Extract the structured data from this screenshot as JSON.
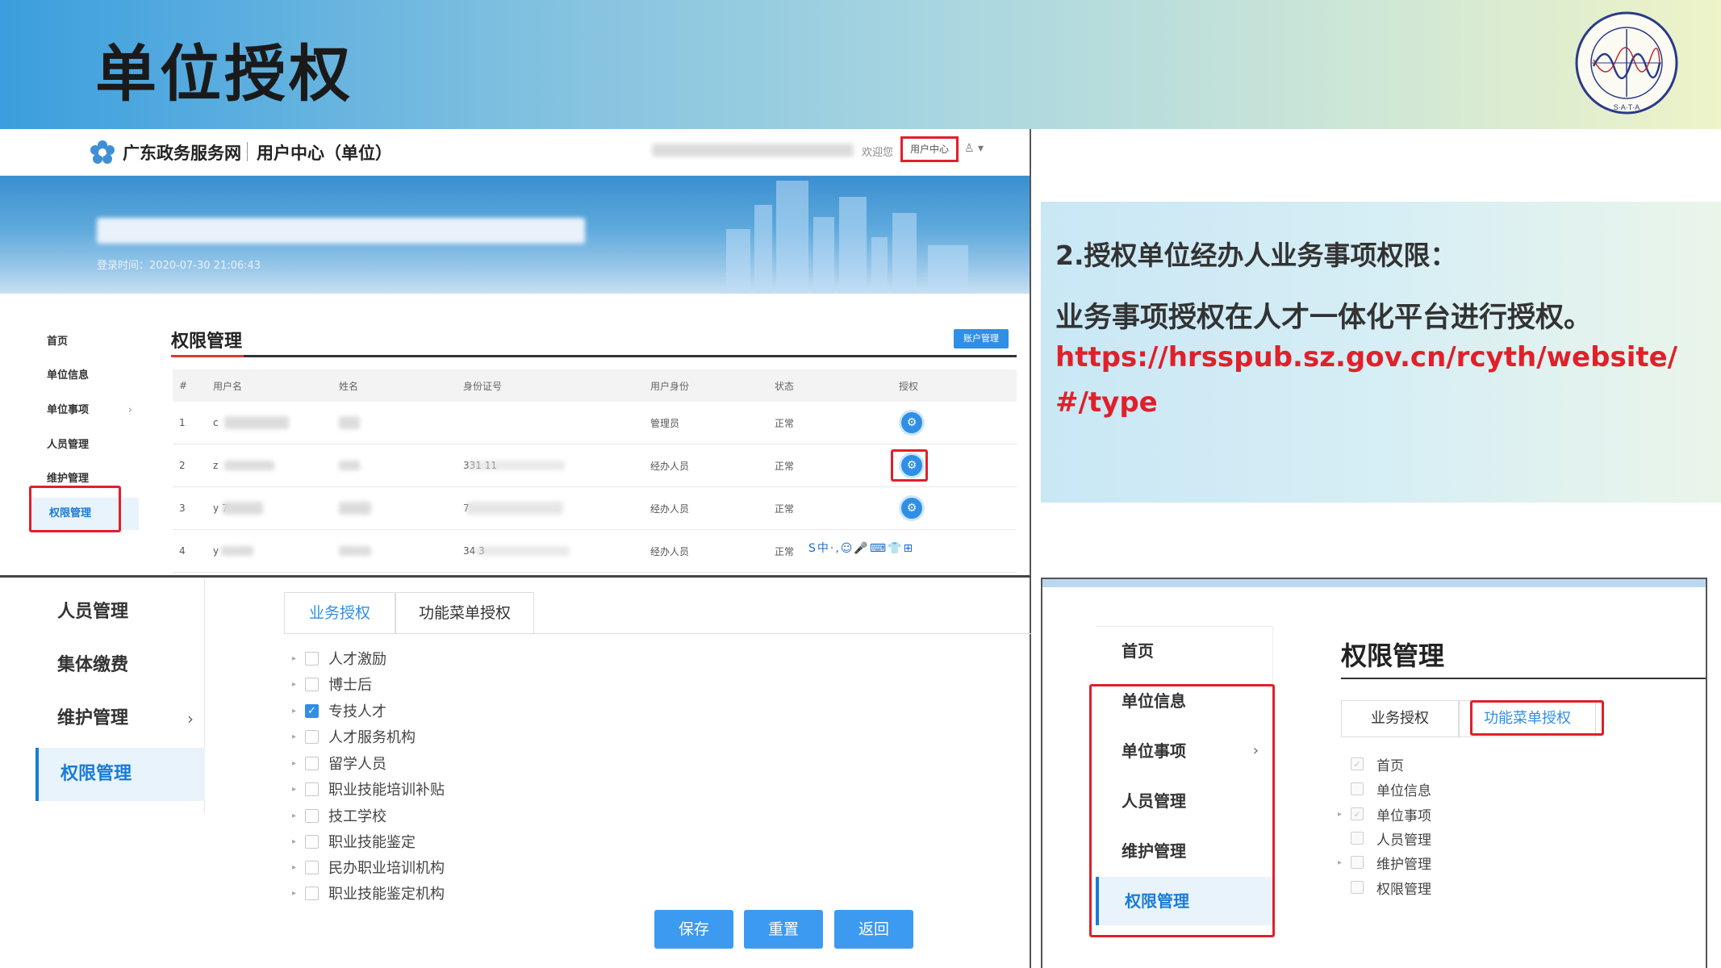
{
  "slide": {
    "title": "单位授权",
    "logo_text": "SHENZHEN ASSOCIATION OF TESTERS AND ANALYSIS",
    "logo_letters": "S·A·T·A"
  },
  "portal": {
    "site_name": "广东政务服务网",
    "center_name": "用户中心（单位）",
    "welcome": "欢迎您",
    "user_center_button": "用户中心",
    "login_time": "登录时间：2020-07-30 21:06:43",
    "sidebar": [
      "首页",
      "单位信息",
      "单位事项",
      "人员管理",
      "维护管理",
      "权限管理"
    ],
    "page_title": "权限管理",
    "account_button": "账户管理",
    "table": {
      "headers": [
        "#",
        "用户名",
        "姓名",
        "身份证号",
        "用户身份",
        "状态",
        "授权"
      ],
      "rows": [
        {
          "index": "1",
          "username": "c",
          "idno": "",
          "role": "管理员",
          "status": "正常"
        },
        {
          "index": "2",
          "username": "z",
          "idno": "331 11",
          "role": "经办人员",
          "status": "正常"
        },
        {
          "index": "3",
          "username": "y 7",
          "idno": "7",
          "role": "经办人员",
          "status": "正常"
        },
        {
          "index": "4",
          "username": "y",
          "idno": "34 3",
          "role": "经办人员",
          "status": "正常"
        }
      ]
    },
    "ime_toolbar": "S中·,☺🎤⌨👕⊞"
  },
  "info": {
    "line1": "2.授权单位经办人业务事项权限：",
    "line2": "业务事项授权在人才一体化平台进行授权。",
    "url": "https://hrsspub.sz.gov.cn/rcyth/website/#/type"
  },
  "auth_form": {
    "sidebar": [
      "人员管理",
      "集体缴费",
      "维护管理",
      "权限管理"
    ],
    "tabs": [
      "业务授权",
      "功能菜单授权"
    ],
    "tree": [
      {
        "label": "人才激励",
        "checked": false
      },
      {
        "label": "博士后",
        "checked": false
      },
      {
        "label": "专技人才",
        "checked": true
      },
      {
        "label": "人才服务机构",
        "checked": false
      },
      {
        "label": "留学人员",
        "checked": false
      },
      {
        "label": "职业技能培训补贴",
        "checked": false
      },
      {
        "label": "技工学校",
        "checked": false
      },
      {
        "label": "职业技能鉴定",
        "checked": false
      },
      {
        "label": "民办职业培训机构",
        "checked": false
      },
      {
        "label": "职业技能鉴定机构",
        "checked": false
      }
    ],
    "buttons": {
      "save": "保存",
      "reset": "重置",
      "back": "返回"
    }
  },
  "menu_auth": {
    "sidebar": [
      "首页",
      "单位信息",
      "单位事项",
      "人员管理",
      "维护管理",
      "权限管理"
    ],
    "title": "权限管理",
    "tabs": [
      "业务授权",
      "功能菜单授权"
    ],
    "tree": [
      "首页",
      "单位信息",
      "单位事项",
      "人员管理",
      "维护管理",
      "权限管理"
    ]
  },
  "colors": {
    "accent": "#2f8fe6",
    "highlight": "#e0202a"
  }
}
